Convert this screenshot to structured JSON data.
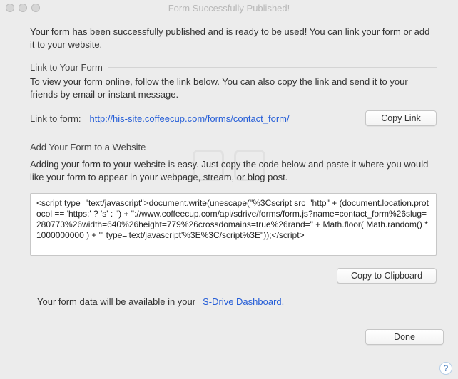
{
  "window": {
    "title": "Form Successfully Published!"
  },
  "intro": "Your form has been successfully published and is ready to be used! You can link your form or add it to your website.",
  "section_link": {
    "heading": "Link to Your Form",
    "desc": "To view your form online, follow the link below. You can also copy the link and send it to your friends by email or instant message.",
    "label": "Link to form:",
    "url": "http://his-site.coffeecup.com/forms/contact_form/",
    "copy_button": "Copy Link"
  },
  "section_embed": {
    "heading": "Add Your Form to a Website",
    "desc": "Adding your form to your website is easy. Just copy the code below and paste it where you would like your form to appear in your webpage, stream, or blog post.",
    "code": "<script type=\"text/javascript\">document.write(unescape(\"%3Cscript src='http\" + (document.location.protocol == 'https:' ? 's' : '') + \"://www.coffeecup.com/api/sdrive/forms/form.js?name=contact_form%26slug=280773%26width=640%26height=779%26crossdomains=true%26rand=\" + Math.floor( Math.random() * 1000000000 ) + \"' type='text/javascript'%3E%3C/script%3E\"));</script>",
    "copy_button": "Copy to Clipboard"
  },
  "dashboard": {
    "text": "Your form data will be available in your",
    "link_label": "S-Drive Dashboard."
  },
  "footer": {
    "done": "Done",
    "help": "?"
  }
}
